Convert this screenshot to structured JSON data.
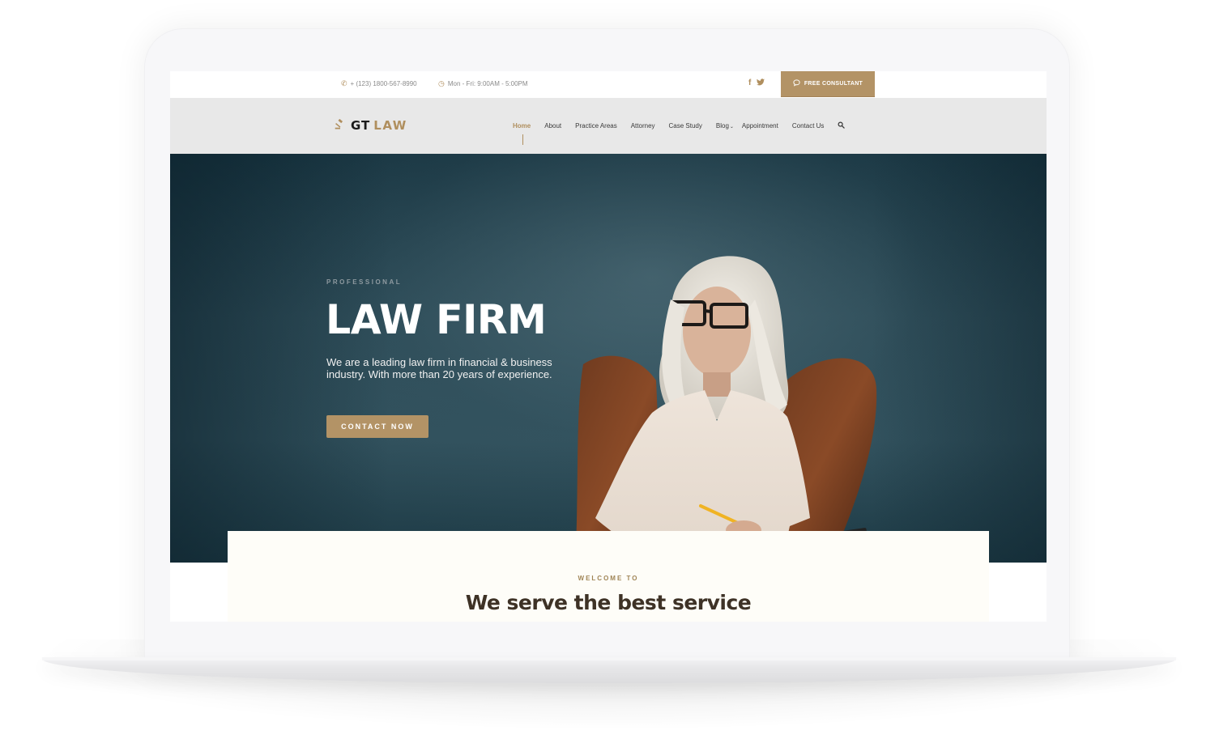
{
  "topbar": {
    "phone_icon": "phone-icon",
    "phone": "+ (123) 1800-567-8990",
    "hours_icon": "clock-icon",
    "hours": "Mon - Fri: 9:00AM - 5:00PM",
    "social": [
      {
        "name": "facebook-icon",
        "glyph": "f"
      },
      {
        "name": "twitter-icon",
        "glyph": "🐦"
      }
    ],
    "cta_icon": "chat-bubble-icon",
    "cta_label": "FREE CONSULTANT"
  },
  "navbar": {
    "logo_icon": "gavel-icon",
    "brand_primary": "GT",
    "brand_secondary": "LAW",
    "menu": [
      {
        "label": "Home",
        "active": true
      },
      {
        "label": "About"
      },
      {
        "label": "Practice Areas"
      },
      {
        "label": "Attorney"
      },
      {
        "label": "Case Study"
      },
      {
        "label": "Blog",
        "has_dropdown": true
      },
      {
        "label": "Appointment"
      },
      {
        "label": "Contact Us"
      }
    ],
    "search_icon": "search-icon"
  },
  "hero": {
    "kicker": "PROFESSIONAL",
    "title": "LAW FIRM",
    "description": "We are a leading law firm in financial & business industry. With more than 20 years of experience.",
    "button_label": "CONTACT NOW",
    "image_alt": "Woman with white hair and glasses seated in a brown leather chair holding a pencil"
  },
  "welcome": {
    "kicker": "WELCOME TO",
    "title": "We serve the best service"
  },
  "colors": {
    "accent": "#b39366",
    "hero_bg": "#2c4b57",
    "nav_bg": "#e8e8e8",
    "heading_dark": "#3e3226"
  }
}
